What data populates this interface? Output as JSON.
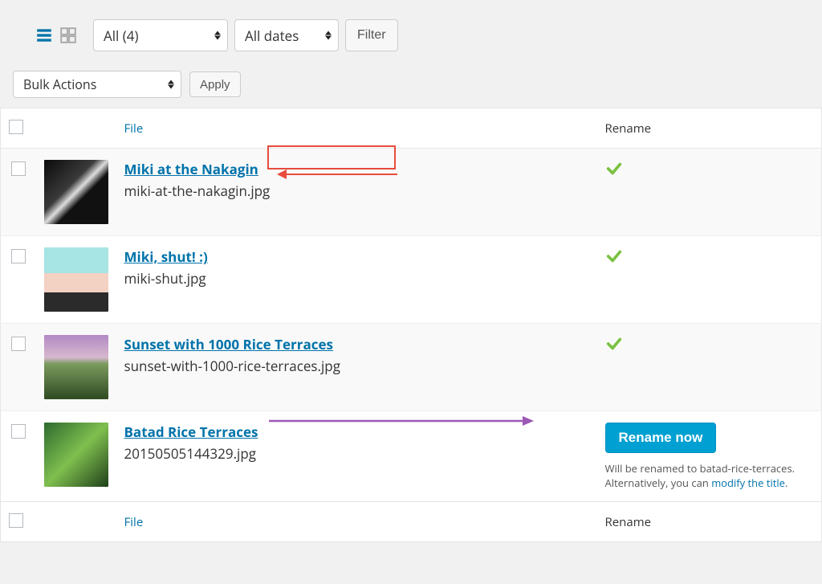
{
  "toolbar": {
    "media_filter": "All (4)",
    "date_filter": "All dates",
    "filter_button": "Filter"
  },
  "bulk": {
    "actions_label": "Bulk Actions",
    "apply_label": "Apply"
  },
  "columns": {
    "file": "File",
    "rename": "Rename"
  },
  "rows": [
    {
      "title": "Miki at the Nakagin",
      "filename": "miki-at-the-nakagin.jpg",
      "status": "ok",
      "thumb_class": "bw",
      "annot": "red"
    },
    {
      "title": "Miki, shut! :)",
      "filename": "miki-shut.jpg",
      "status": "ok",
      "thumb_class": "face"
    },
    {
      "title": "Sunset with 1000 Rice Terraces",
      "filename": "sunset-with-1000-rice-terraces.jpg",
      "status": "ok",
      "thumb_class": "sunset"
    },
    {
      "title": "Batad Rice Terraces",
      "filename": "20150505144329.jpg",
      "status": "needs_rename",
      "thumb_class": "batad",
      "annot": "purple"
    }
  ],
  "rename_action": {
    "button_label": "Rename now",
    "note_prefix": "Will be renamed to ",
    "note_target": "batad-rice-terraces",
    "note_suffix": ". Alternatively, you can ",
    "note_link": "modify the title",
    "note_end": "."
  },
  "colors": {
    "link": "#0073aa",
    "ok_check": "#7ac142",
    "rename_btn": "#00a0d2",
    "annot_red": "#e74c3c",
    "annot_purple": "#9b59b6"
  }
}
